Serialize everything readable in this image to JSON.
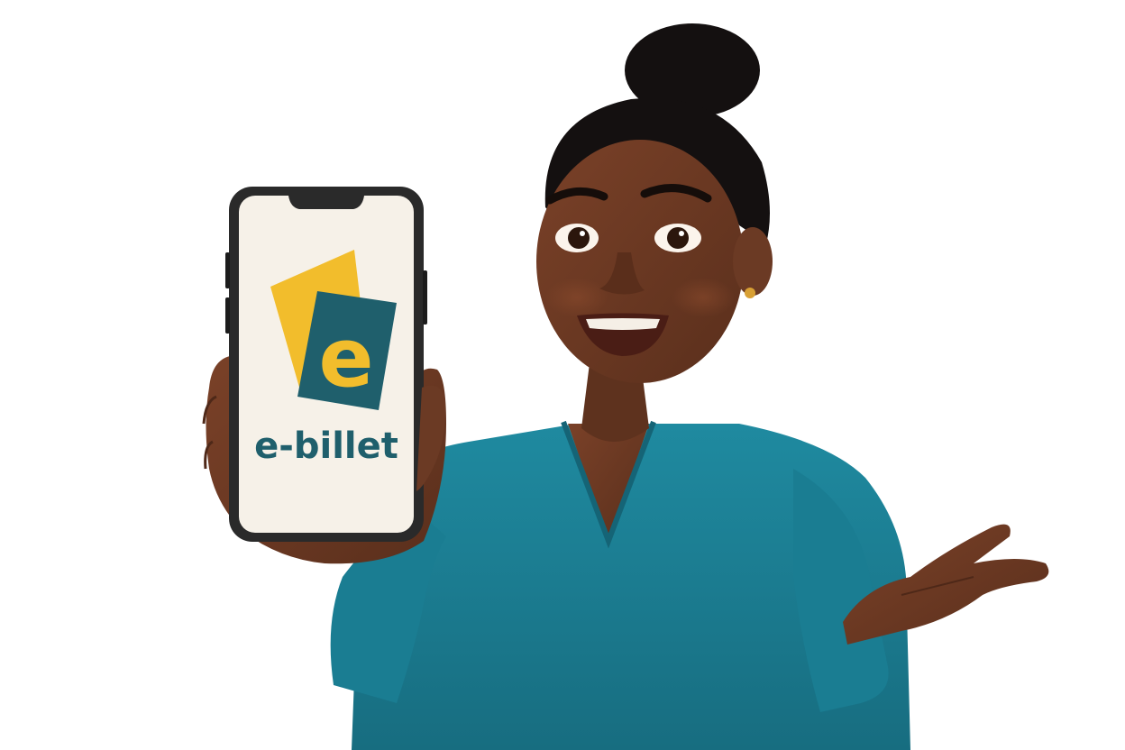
{
  "scene": {
    "description_role": "illustration",
    "app_logo_text": "e-billet",
    "app_logo_letter": "e",
    "colors": {
      "background": "#ffffff",
      "brand_teal": "#1f5f6c",
      "brand_yellow": "#f2bd2c",
      "phone_frame": "#2a2a2a",
      "phone_screen": "#f6f1e8",
      "shirt": "#1d7f94",
      "skin": "#6b3a24",
      "hair": "#141010"
    },
    "icons": [
      "phone-icon",
      "e-billet-logo-icon"
    ]
  }
}
